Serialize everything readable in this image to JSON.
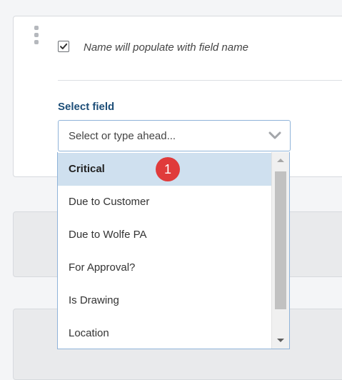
{
  "field_card": {
    "checkbox_checked": true,
    "checkbox_label": "Name will populate with field name",
    "select_label": "Select field",
    "select_placeholder": "Select or type ahead..."
  },
  "dropdown": {
    "options": [
      {
        "label": "Critical",
        "highlighted": true
      },
      {
        "label": "Due to Customer"
      },
      {
        "label": "Due to Wolfe PA"
      },
      {
        "label": "For Approval?"
      },
      {
        "label": "Is Drawing"
      },
      {
        "label": "Location"
      }
    ],
    "badge_number": "1"
  },
  "colors": {
    "label_blue": "#1d4e78",
    "select_border": "#8fb3d9",
    "highlight_bg": "#cfe0ef",
    "badge_red": "#e03b3b"
  },
  "icons": {
    "drag_handle": "drag-handle-icon",
    "checkbox": "checkmark-icon",
    "chevron": "chevron-down-icon",
    "scroll_up": "scroll-up-arrow-icon",
    "scroll_down": "scroll-down-arrow-icon"
  }
}
